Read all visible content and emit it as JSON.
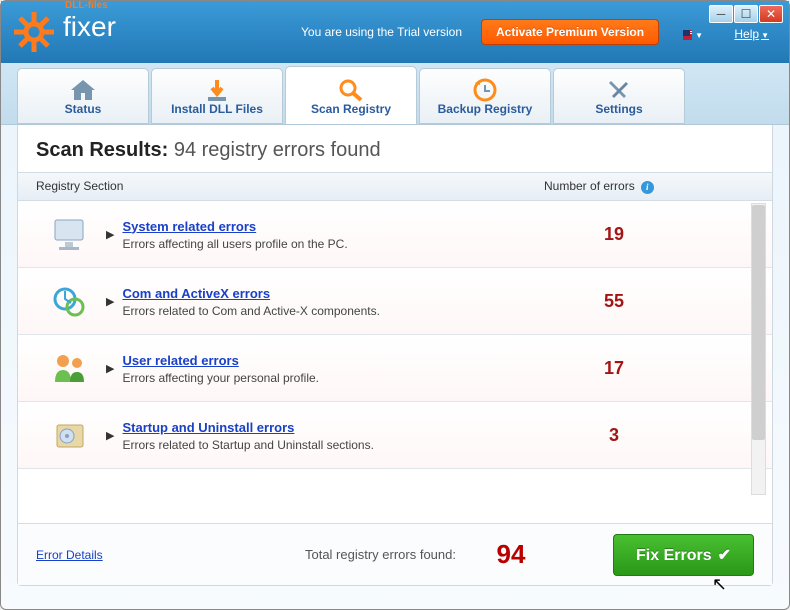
{
  "header": {
    "logo_text": "fixer",
    "logo_super": "DLL-files",
    "trial_text": "You are using the Trial version",
    "activate_label": "Activate Premium Version",
    "help_label": "Help"
  },
  "tabs": [
    {
      "id": "status",
      "label": "Status"
    },
    {
      "id": "install",
      "label": "Install DLL Files"
    },
    {
      "id": "scan",
      "label": "Scan Registry"
    },
    {
      "id": "backup",
      "label": "Backup Registry"
    },
    {
      "id": "settings",
      "label": "Settings"
    }
  ],
  "results": {
    "heading_bold": "Scan Results:",
    "heading_sub": "94 registry errors found",
    "col_section": "Registry Section",
    "col_errors": "Number of errors",
    "rows": [
      {
        "title": "System related errors",
        "desc": "Errors affecting all users profile on the PC.",
        "count": "19"
      },
      {
        "title": "Com and ActiveX errors",
        "desc": "Errors related to Com and Active-X components.",
        "count": "55"
      },
      {
        "title": "User related errors",
        "desc": "Errors affecting your personal profile.",
        "count": "17"
      },
      {
        "title": "Startup and Uninstall errors",
        "desc": "Errors related to Startup and Uninstall sections.",
        "count": "3"
      }
    ],
    "error_details": "Error Details",
    "total_label": "Total registry errors found:",
    "total_count": "94",
    "fix_label": "Fix Errors"
  }
}
